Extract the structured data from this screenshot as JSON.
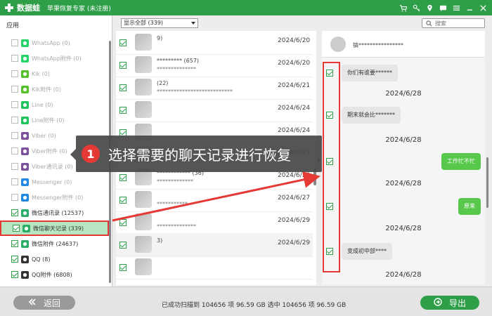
{
  "titlebar": {
    "brand": "数据蛙",
    "subtitle": "苹果恢复专家 (未注册)",
    "icons": [
      "cart-icon",
      "key-icon",
      "location-icon",
      "message-icon",
      "menu-icon",
      "minimize-icon",
      "close-icon"
    ]
  },
  "sidebar": {
    "header": "应用",
    "items": [
      {
        "label": "WhatsApp (0)",
        "icon": "whatsapp-icon",
        "color": "#25d366",
        "checked": false
      },
      {
        "label": "WhatsApp附件 (0)",
        "icon": "whatsapp-icon",
        "color": "#25d366",
        "checked": false
      },
      {
        "label": "Kik (0)",
        "icon": "kik-icon",
        "color": "#56c12b",
        "checked": false
      },
      {
        "label": "Kik附件 (0)",
        "icon": "kik-icon",
        "color": "#56c12b",
        "checked": false
      },
      {
        "label": "Line (0)",
        "icon": "line-icon",
        "color": "#1fc35c",
        "checked": false
      },
      {
        "label": "Line附件 (0)",
        "icon": "line-icon",
        "color": "#1fc35c",
        "checked": false
      },
      {
        "label": "Viber (0)",
        "icon": "viber-icon",
        "color": "#7b519d",
        "checked": false
      },
      {
        "label": "Viber附件 (0)",
        "icon": "viber-icon",
        "color": "#7b519d",
        "checked": false
      },
      {
        "label": "Viber通讯录 (0)",
        "icon": "viber-icon",
        "color": "#7b519d",
        "checked": false
      },
      {
        "label": "Messenger (0)",
        "icon": "messenger-icon",
        "color": "#1e88e5",
        "checked": false
      },
      {
        "label": "Messenger附件 (0)",
        "icon": "messenger-icon",
        "color": "#1e88e5",
        "checked": false
      },
      {
        "label": "微信通讯录 (12537)",
        "icon": "wechat-icon",
        "color": "#2aae67",
        "checked": true
      },
      {
        "label": "微信聊天记录 (339)",
        "icon": "wechat-icon",
        "color": "#2aae67",
        "checked": true,
        "selected": true
      },
      {
        "label": "微信附件 (24637)",
        "icon": "wechat-icon",
        "color": "#2aae67",
        "checked": true
      },
      {
        "label": "QQ (8)",
        "icon": "qq-icon",
        "color": "#333333",
        "checked": true
      },
      {
        "label": "QQ附件 (6808)",
        "icon": "qq-icon",
        "color": "#333333",
        "checked": true
      },
      {
        "label": "应用文档 (1963)",
        "icon": "document-icon",
        "color": "#999999",
        "checked": true
      }
    ]
  },
  "filter": {
    "selected": "显示全部 (339)"
  },
  "list": {
    "rows": [
      {
        "name": "9)",
        "preview": "",
        "date": "2024/6/20"
      },
      {
        "name": "********* (657)",
        "preview": "**************",
        "date": "2024/6/20"
      },
      {
        "name": "(22)",
        "preview": "***************************",
        "date": "2024/6/21"
      },
      {
        "name": "",
        "preview": "",
        "date": "2024/6/24"
      },
      {
        "name": "",
        "preview": "",
        "date": "2024/6/24"
      },
      {
        "name": "",
        "preview": "",
        "date": "2024/6/25"
      },
      {
        "name": "************ (36)",
        "preview": "*************",
        "date": "2024/6/26"
      },
      {
        "name": "",
        "preview": "***********",
        "date": "2024/6/27"
      },
      {
        "name": "",
        "preview": "**************",
        "date": "2024/6/29"
      },
      {
        "name": "3)",
        "preview": "",
        "date": "2024/6/29"
      },
      {
        "name": "",
        "preview": "",
        "date": ""
      }
    ]
  },
  "search": {
    "placeholder": "搜索"
  },
  "chat": {
    "contact_name": "镐****************",
    "messages": [
      {
        "dir": "in",
        "text": "你们有谁要******"
      },
      {
        "dir": "date",
        "text": "2024/6/28"
      },
      {
        "dir": "in",
        "text": "期末就会比*******"
      },
      {
        "dir": "date",
        "text": "2024/6/28"
      },
      {
        "dir": "out",
        "text": "工作忙不忙"
      },
      {
        "dir": "date",
        "text": "2024/6/28"
      },
      {
        "dir": "out",
        "text": "原来"
      },
      {
        "dir": "date",
        "text": "2024/6/28"
      },
      {
        "dir": "in",
        "text": "变成初中部****"
      },
      {
        "dir": "date",
        "text": "2024/6/28"
      }
    ]
  },
  "callout": {
    "number": "1",
    "text": "选择需要的聊天记录进行恢复"
  },
  "footer": {
    "back_label": "返回",
    "export_label": "导出",
    "status": "已成功扫描到 104656 项 96.59 GB  选中 104656 项 96.59 GB"
  },
  "colors": {
    "brand_green": "#2e9e48",
    "highlight_red": "#e53935",
    "selected_bg": "#b8e6c2",
    "bubble_out": "#57c84c"
  }
}
